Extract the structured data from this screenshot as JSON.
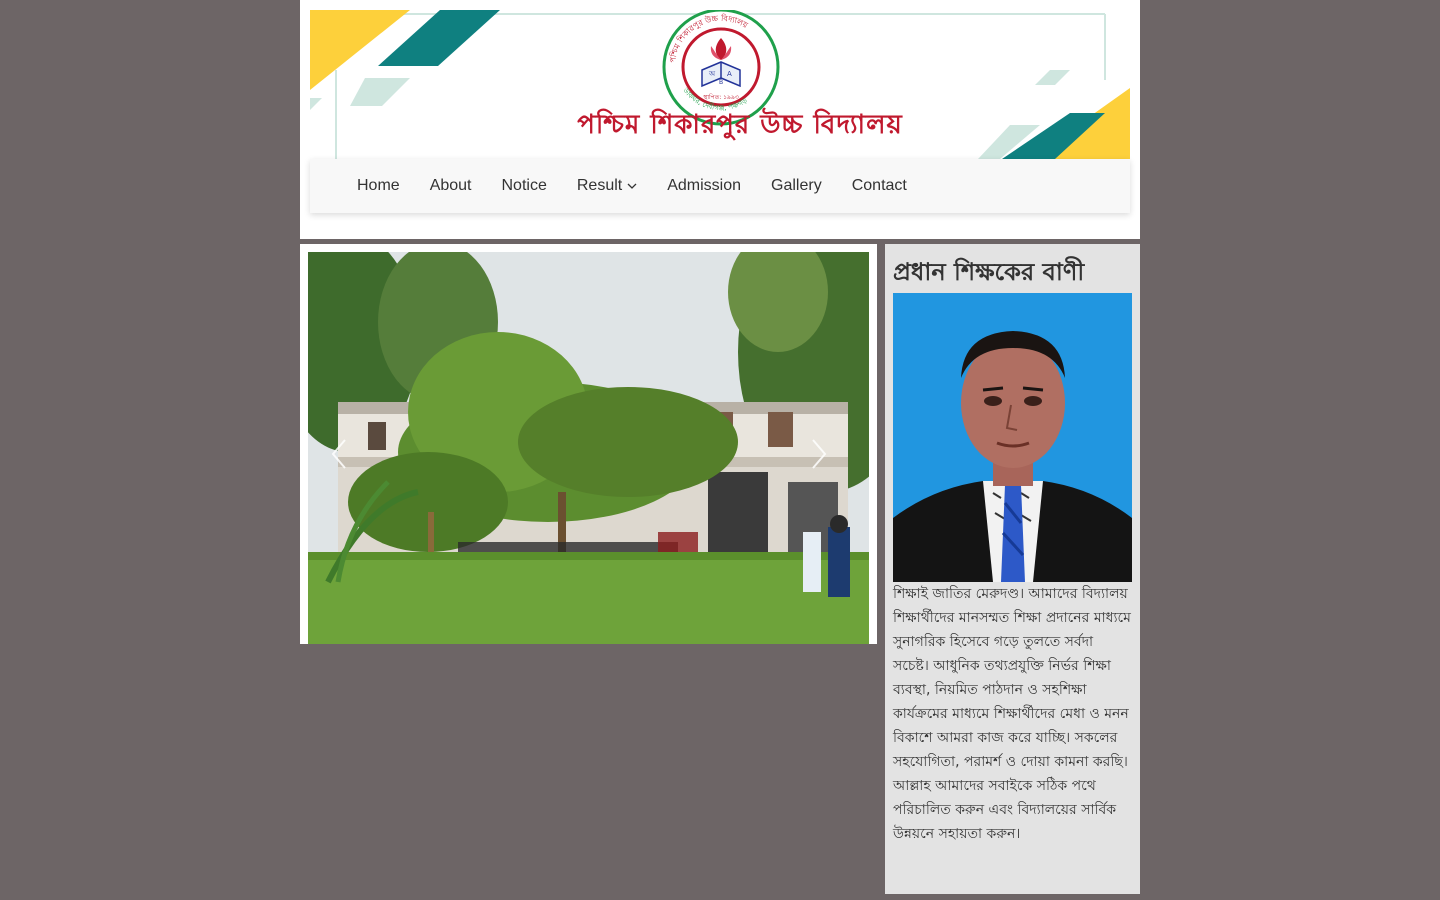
{
  "header": {
    "school_name": "পশ্চিম শিকারপুর উচ্চ বিদ্যালয়",
    "logo_ring_text": "পশ্চিম শিকারপুর উচ্চ বিদ্যালয়",
    "logo_est_text": "স্থাপিত: ১৯৯৩",
    "logo_address_text": "ডাকঘর, দেবীগঞ্জ, পঞ্চগড়",
    "logo_book_letters": [
      "অ",
      "B",
      "A"
    ],
    "colors": {
      "yellow": "#fdd03b",
      "teal": "#0f8080",
      "light_teal": "#cfe6df",
      "title_red": "#c0192e"
    }
  },
  "nav": {
    "items": [
      {
        "label": "Home"
      },
      {
        "label": "About"
      },
      {
        "label": "Notice"
      },
      {
        "label": "Result",
        "has_dropdown": true
      },
      {
        "label": "Admission"
      },
      {
        "label": "Gallery"
      },
      {
        "label": "Contact"
      }
    ]
  },
  "slider": {
    "prev_icon": "chevron-left-icon",
    "next_icon": "chevron-right-icon",
    "image": "school-building-photo"
  },
  "sidebar": {
    "heading": "প্রধান শিক্ষকের বাণী",
    "photo": "headmaster-portrait",
    "message": "শিক্ষাই জাতির মেরুদণ্ড। আমাদের বিদ্যালয় শিক্ষার্থীদের মানসম্মত শিক্ষা প্রদানের মাধ্যমে সুনাগরিক হিসেবে গড়ে তুলতে সর্বদা সচেষ্ট। আধুনিক তথ্যপ্রযুক্তি নির্ভর শিক্ষা ব্যবস্থা, নিয়মিত পাঠদান ও সহশিক্ষা কার্যক্রমের মাধ্যমে শিক্ষার্থীদের মেধা ও মনন বিকাশে আমরা কাজ করে যাচ্ছি। সকলের সহযোগিতা, পরামর্শ ও দোয়া কামনা করছি। আল্লাহ আমাদের সবাইকে সঠিক পথে পরিচালিত করুন এবং বিদ্যালয়ের সার্বিক উন্নয়নে সহায়তা করুন।"
  }
}
